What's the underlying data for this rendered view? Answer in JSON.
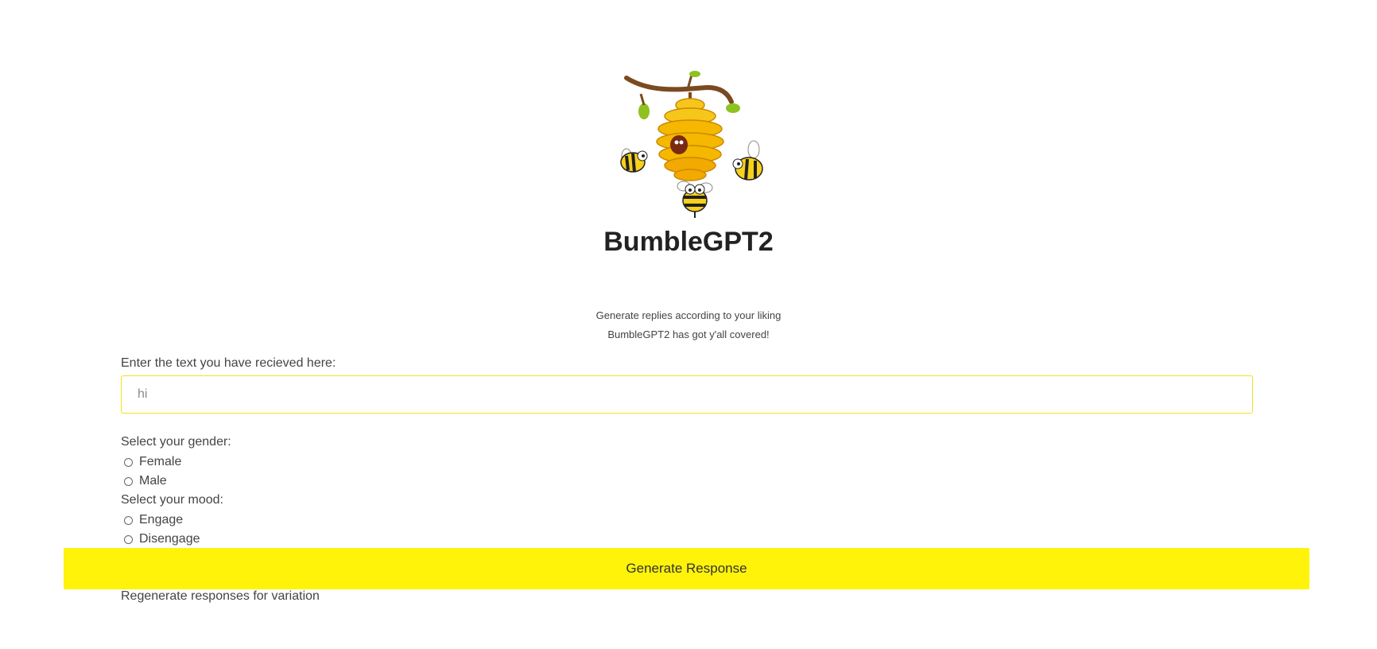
{
  "app": {
    "title": "BumbleGPT2",
    "logo_icon": "beehive-with-bees-icon"
  },
  "intro": {
    "line1": "Generate replies according to your liking",
    "line2": "BumbleGPT2 has got y'all covered!"
  },
  "text_input": {
    "label": "Enter the text you have recieved here:",
    "value": "hi"
  },
  "gender": {
    "label": "Select your gender:",
    "options": [
      "Female",
      "Male"
    ]
  },
  "mood": {
    "label": "Select your mood:",
    "options": [
      "Engage",
      "Disengage"
    ]
  },
  "actions": {
    "generate_label": "Generate Response"
  },
  "footer_note": "Regenerate responses for variation",
  "colors": {
    "accent": "#fff30a",
    "input_border": "#f2e21a",
    "hive": "#f5b700",
    "text": "#444444"
  }
}
